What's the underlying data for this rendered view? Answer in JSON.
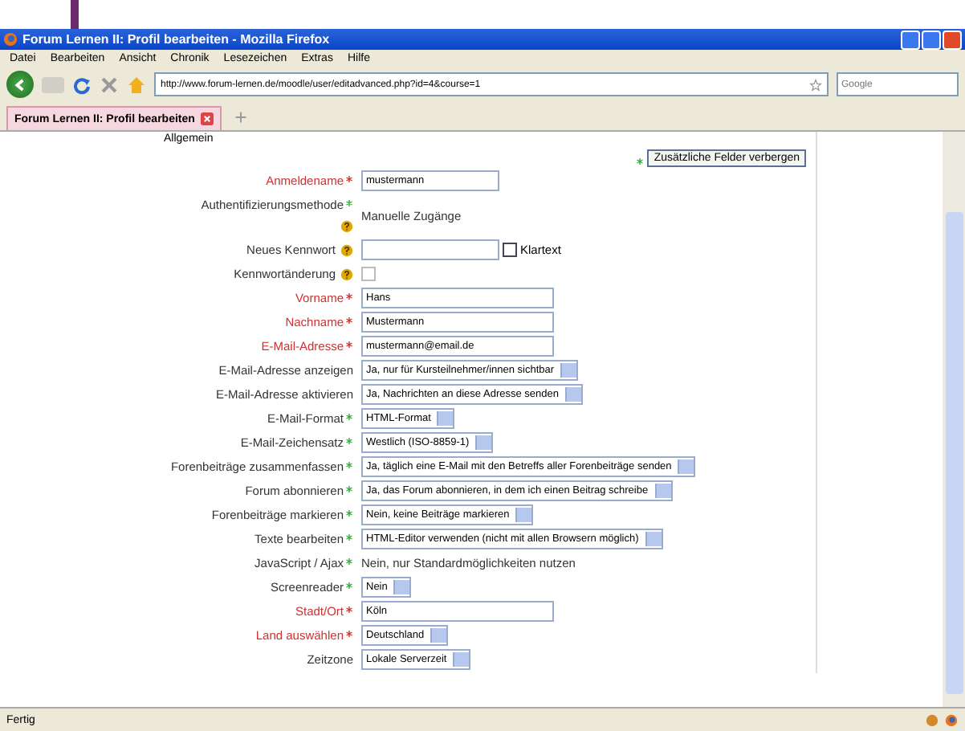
{
  "window": {
    "title": "Forum Lernen II: Profil bearbeiten - Mozilla Firefox"
  },
  "menu": [
    "Datei",
    "Bearbeiten",
    "Ansicht",
    "Chronik",
    "Lesezeichen",
    "Extras",
    "Hilfe"
  ],
  "address_bar": {
    "value": "http://www.forum-lernen.de/moodle/user/editadvanced.php?id=4&course=1"
  },
  "search": {
    "placeholder": "Google"
  },
  "tabs": [
    {
      "label": "Forum Lernen II: Profil bearbeiten",
      "selected": true
    }
  ],
  "form": {
    "legend": "Allgemein",
    "toggle_button": "Zusätzliche Felder verbergen",
    "rows": [
      {
        "kind": "text",
        "label": "Anmeldename",
        "highlight": true,
        "required": true,
        "help": false,
        "value": "mustermann"
      },
      {
        "kind": "static",
        "label": "Authentifizierungsmethode",
        "highlight": false,
        "required": true,
        "help": true,
        "value": "Manuelle Zugänge"
      },
      {
        "kind": "password",
        "label": "Neues Kennwort",
        "highlight": false,
        "required": false,
        "help": true,
        "value": "",
        "checkbox_label": "Klartext",
        "checked": false
      },
      {
        "kind": "checkbox",
        "label": "Kennwortänderung",
        "highlight": false,
        "required": false,
        "help": true,
        "checked": false
      },
      {
        "kind": "text",
        "label": "Vorname",
        "highlight": true,
        "required": true,
        "help": false,
        "value": "Hans"
      },
      {
        "kind": "text",
        "label": "Nachname",
        "highlight": true,
        "required": true,
        "help": false,
        "value": "Mustermann"
      },
      {
        "kind": "text",
        "label": "E-Mail-Adresse",
        "highlight": true,
        "required": true,
        "help": false,
        "value": "mustermann@email.de"
      },
      {
        "kind": "select",
        "label": "E-Mail-Adresse anzeigen",
        "highlight": false,
        "required": false,
        "help": false,
        "value": "Ja, nur für Kursteilnehmer/innen sichtbar"
      },
      {
        "kind": "select",
        "label": "E-Mail-Adresse aktivieren",
        "highlight": false,
        "required": false,
        "help": false,
        "value": "Ja, Nachrichten an diese Adresse senden"
      },
      {
        "kind": "select",
        "label": "E-Mail-Format",
        "highlight": false,
        "required": true,
        "help": false,
        "value": "HTML-Format"
      },
      {
        "kind": "select",
        "label": "E-Mail-Zeichensatz",
        "highlight": false,
        "required": true,
        "help": false,
        "value": "Westlich (ISO-8859-1)"
      },
      {
        "kind": "select",
        "label": "Forenbeiträge zusammenfassen",
        "highlight": false,
        "required": true,
        "help": false,
        "value": "Ja, täglich eine E-Mail mit den Betreffs aller Forenbeiträge senden"
      },
      {
        "kind": "select",
        "label": "Forum abonnieren",
        "highlight": false,
        "required": true,
        "help": false,
        "value": "Ja, das Forum abonnieren, in dem ich einen Beitrag schreibe"
      },
      {
        "kind": "select",
        "label": "Forenbeiträge markieren",
        "highlight": false,
        "required": true,
        "help": false,
        "value": "Nein, keine Beiträge markieren"
      },
      {
        "kind": "select",
        "label": "Texte bearbeiten",
        "highlight": false,
        "required": true,
        "help": false,
        "value": "HTML-Editor verwenden (nicht mit allen Browsern möglich)"
      },
      {
        "kind": "static",
        "label": "JavaScript / Ajax",
        "highlight": false,
        "required": true,
        "help": false,
        "value": "Nein, nur Standardmöglichkeiten nutzen"
      },
      {
        "kind": "select",
        "label": "Screenreader",
        "highlight": false,
        "required": true,
        "help": false,
        "value": "Nein"
      },
      {
        "kind": "text",
        "label": "Stadt/Ort",
        "highlight": true,
        "required": true,
        "help": false,
        "value": "Köln"
      },
      {
        "kind": "select",
        "label": "Land auswählen",
        "highlight": true,
        "required": true,
        "help": false,
        "value": "Deutschland"
      },
      {
        "kind": "select",
        "label": "Zeitzone",
        "highlight": false,
        "required": false,
        "help": false,
        "value": "Lokale Serverzeit"
      }
    ]
  },
  "status_bar": {
    "text": "Fertig"
  }
}
